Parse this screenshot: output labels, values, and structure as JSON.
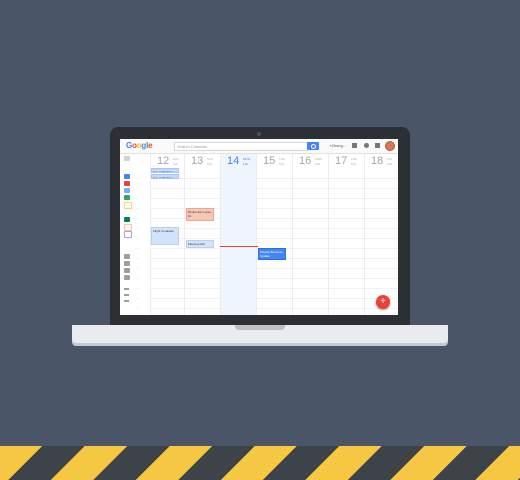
{
  "app": {
    "logo_letters": [
      {
        "ch": "G",
        "color": "#4285f4"
      },
      {
        "ch": "o",
        "color": "#ea4335"
      },
      {
        "ch": "o",
        "color": "#fbbc05"
      },
      {
        "ch": "g",
        "color": "#4285f4"
      },
      {
        "ch": "l",
        "color": "#34a853"
      },
      {
        "ch": "e",
        "color": "#ea4335"
      }
    ],
    "search_placeholder": "Search Calendar",
    "user_name": "+Zhong...",
    "header_icons": [
      "grid-view-icon",
      "settings-icon",
      "apps-icon"
    ],
    "avatar": "avatar"
  },
  "sidebar": {
    "top_icon": "mini-calendar-icon",
    "calendar_colors": [
      "#4285f4",
      "#ea4335",
      "#7baaf7",
      "#34a853",
      "#fbd75b",
      "#0b8043",
      "#f6bfa6",
      "#b39ddb",
      "#9e9e9e",
      "#9e9e9e",
      "#9e9e9e",
      "#9e9e9e"
    ]
  },
  "days": [
    {
      "num": "12",
      "sub1": "SAT",
      "sub2": "Feb",
      "today": false
    },
    {
      "num": "13",
      "sub1": "SUN",
      "sub2": "Feb",
      "today": false
    },
    {
      "num": "14",
      "sub1": "MON",
      "sub2": "Feb",
      "today": true
    },
    {
      "num": "15",
      "sub1": "TUE",
      "sub2": "Feb",
      "today": false
    },
    {
      "num": "16",
      "sub1": "WED",
      "sub2": "Feb",
      "today": false
    },
    {
      "num": "17",
      "sub1": "THU",
      "sub2": "Feb",
      "today": false
    },
    {
      "num": "18",
      "sub1": "FRI",
      "sub2": "Feb",
      "today": false
    }
  ],
  "events": {
    "allday_1": "Kay at Birthday",
    "allday_2": "Kay at Birthday",
    "salmon": "Drinks don't open hit",
    "flight": "Flight to Hawaii",
    "meeting": "Meeting with",
    "blue": "Weekly Business Update"
  },
  "fab_label": "+"
}
